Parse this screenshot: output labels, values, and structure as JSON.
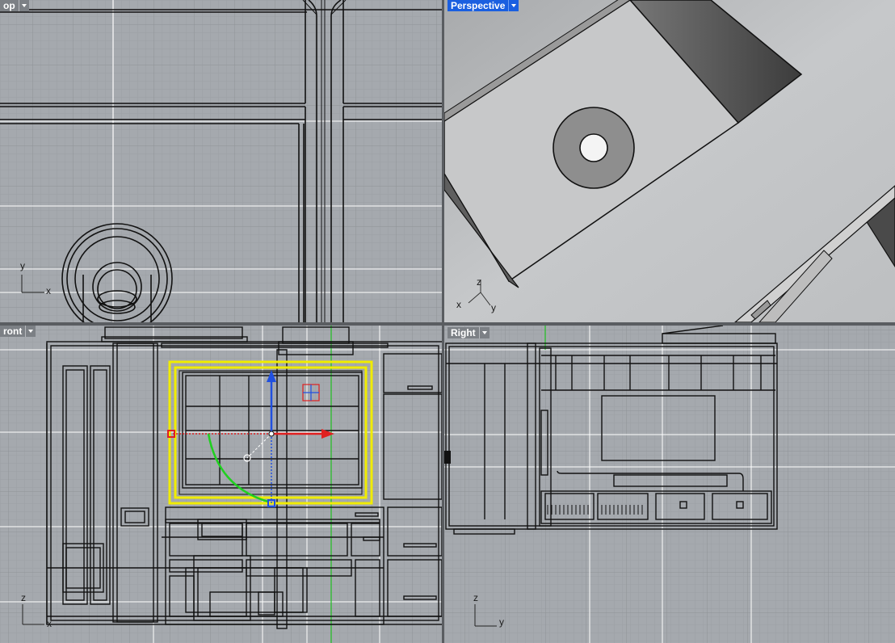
{
  "viewports": {
    "top": {
      "label": "op",
      "axis_x": "x",
      "axis_y": "y"
    },
    "perspective": {
      "label": "Perspective",
      "axis_x": "x",
      "axis_y": "y",
      "axis_z": "z"
    },
    "front": {
      "label": "ront",
      "axis_x": "x",
      "axis_z": "z"
    },
    "right": {
      "label": "Right",
      "axis_y": "y",
      "axis_z": "z"
    }
  },
  "colors": {
    "viewport_bg": "#a5a9ae",
    "active_tab": "#1a5fe0",
    "selection_highlight": "#e8e400",
    "gumball_x": "#e02020",
    "gumball_y": "#2050e0",
    "gumball_rotate": "#20d020"
  },
  "icons": {
    "dropdown": "chevron-down-icon",
    "gumball": "gumball-widget-icon"
  }
}
